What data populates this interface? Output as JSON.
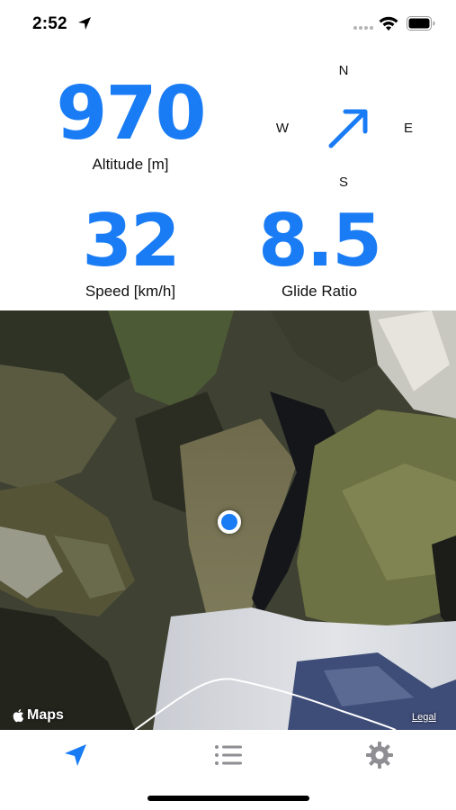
{
  "status_bar": {
    "time": "2:52",
    "icons": [
      "location-arrow-icon",
      "signal-icon",
      "wifi-icon",
      "battery-icon"
    ]
  },
  "instruments": {
    "altitude": {
      "value": "970",
      "label": "Altitude [m]"
    },
    "speed": {
      "value": "32",
      "label": "Speed [km/h]"
    },
    "glide_ratio": {
      "value": "8.5",
      "label": "Glide Ratio"
    }
  },
  "compass": {
    "north": "N",
    "south": "S",
    "west": "W",
    "east": "E",
    "heading_icon": "heading-arrow-icon"
  },
  "map": {
    "attribution": "Maps",
    "legal": "Legal",
    "style": "satellite"
  },
  "tab_bar": {
    "tabs": [
      {
        "icon": "location-arrow-icon",
        "selected": true
      },
      {
        "icon": "list-icon",
        "selected": false
      },
      {
        "icon": "gear-icon",
        "selected": false
      }
    ]
  },
  "colors": {
    "accent": "#1a7cf5",
    "inactive_tab": "#8e8e93"
  }
}
